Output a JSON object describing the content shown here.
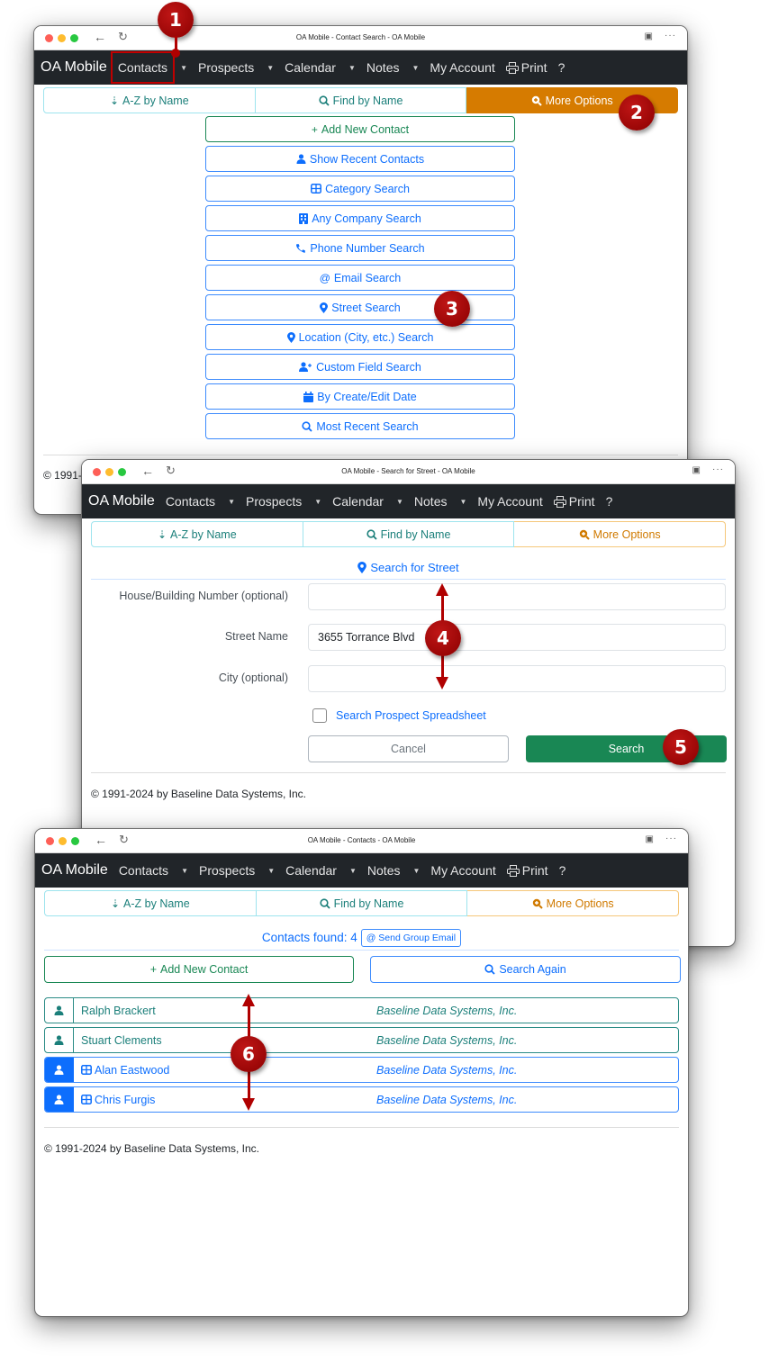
{
  "nav": {
    "brand": "OA Mobile",
    "items": [
      {
        "label": "Contacts",
        "has_caret": true
      },
      {
        "label": "Prospects",
        "has_caret": true
      },
      {
        "label": "Calendar",
        "has_caret": true
      },
      {
        "label": "Notes",
        "has_caret": true
      },
      {
        "label": "My Account",
        "has_caret": false
      }
    ],
    "print_label": "Print",
    "help_label": "?"
  },
  "tabs": {
    "az": "A-Z by Name",
    "find": "Find by Name",
    "more": "More Options"
  },
  "browser": {
    "back_icon": "arrow-left-icon",
    "reload_icon": "reload-icon",
    "reader_icon": "reader-icon",
    "more_icon": "ellipsis-icon",
    "more_glyph": "···"
  },
  "window1": {
    "title": "OA Mobile - Contact Search - OA Mobile",
    "options": [
      {
        "icon": "plus-icon",
        "glyph": "+",
        "label": "Add New Contact",
        "style": "green"
      },
      {
        "icon": "person-icon",
        "glyph": "",
        "label": "Show Recent Contacts",
        "style": "blue"
      },
      {
        "icon": "table-icon",
        "glyph": "",
        "label": "Category Search",
        "style": "blue"
      },
      {
        "icon": "building-icon",
        "glyph": "",
        "label": "Any Company Search",
        "style": "blue"
      },
      {
        "icon": "phone-icon",
        "glyph": "",
        "label": "Phone Number Search",
        "style": "blue"
      },
      {
        "icon": "at-icon",
        "glyph": "@",
        "label": "Email Search",
        "style": "blue"
      },
      {
        "icon": "map-pin-icon",
        "glyph": "",
        "label": "Street Search",
        "style": "blue"
      },
      {
        "icon": "map-pin-icon",
        "glyph": "",
        "label": "Location (City, etc.) Search",
        "style": "blue"
      },
      {
        "icon": "person-plus-icon",
        "glyph": "",
        "label": "Custom Field Search",
        "style": "blue"
      },
      {
        "icon": "calendar-icon",
        "glyph": "",
        "label": "By Create/Edit Date",
        "style": "blue"
      },
      {
        "icon": "search-icon",
        "glyph": "",
        "label": "Most Recent Search",
        "style": "blue"
      }
    ],
    "footer_partial": "© 1991-"
  },
  "window2": {
    "title": "OA Mobile - Search for Street - OA Mobile",
    "heading": "Search for Street",
    "fields": [
      {
        "label": "House/Building Number (optional)",
        "value": ""
      },
      {
        "label": "Street Name",
        "value": "3655 Torrance Blvd"
      },
      {
        "label": "City (optional)",
        "value": ""
      }
    ],
    "checkbox_label": "Search Prospect Spreadsheet",
    "checkbox_checked": false,
    "cancel_label": "Cancel",
    "search_label": "Search",
    "footer": "© 1991-2024 by Baseline Data Systems, Inc."
  },
  "window3": {
    "title": "OA Mobile - Contacts - OA Mobile",
    "found_label": "Contacts found: 4",
    "group_email_label": "Send Group Email",
    "add_label": "Add New Contact",
    "search_again_label": "Search Again",
    "contacts": [
      {
        "name": "Ralph Brackert",
        "company": "Baseline Data Systems, Inc.",
        "style": "teal",
        "has_category": false
      },
      {
        "name": "Stuart Clements",
        "company": "Baseline Data Systems, Inc.",
        "style": "teal",
        "has_category": false
      },
      {
        "name": "Alan Eastwood",
        "company": "Baseline Data Systems, Inc.",
        "style": "blue",
        "has_category": true
      },
      {
        "name": "Chris Furgis",
        "company": "Baseline Data Systems, Inc.",
        "style": "blue",
        "has_category": true
      }
    ],
    "footer": "© 1991-2024 by Baseline Data Systems, Inc."
  },
  "callouts": [
    "1",
    "2",
    "3",
    "4",
    "5",
    "6"
  ],
  "colors": {
    "navbar": "#212529",
    "primary": "#0d6efd",
    "success": "#198754",
    "teal": "#1b7f7a",
    "warning": "#d67b00",
    "callout": "#b00000"
  }
}
